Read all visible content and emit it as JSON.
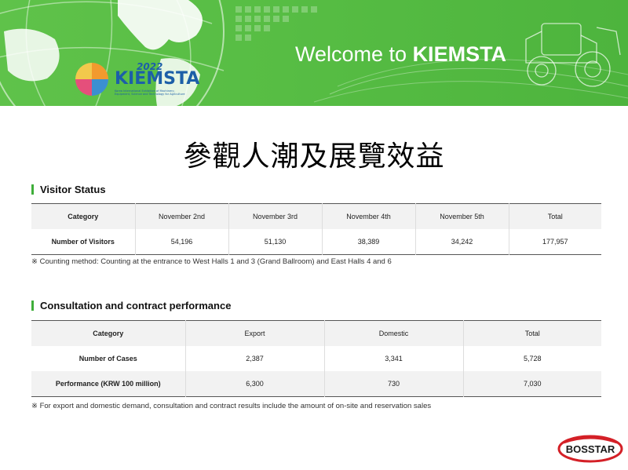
{
  "banner": {
    "logo_year": "2022",
    "logo_name": "KIEMSTA",
    "logo_subtitle": "Korea International Exhibition of Machinery, Equipment, Science and Technology for Agriculture",
    "welcome_prefix": "Welcome to ",
    "welcome_brand": "KIEMSTA",
    "bg_color": "#57bd44"
  },
  "page_title": "參觀人潮及展覽效益",
  "visitor_status": {
    "title": "Visitor Status",
    "headers": [
      "Category",
      "November 2nd",
      "November 3rd",
      "November 4th",
      "November 5th",
      "Total"
    ],
    "rows": [
      [
        "Number of Visitors",
        "54,196",
        "51,130",
        "38,389",
        "34,242",
        "177,957"
      ]
    ],
    "note": "※ Counting method: Counting at the entrance to West Halls 1 and 3 (Grand Ballroom) and East Halls 4 and 6"
  },
  "consultation": {
    "title": "Consultation and contract performance",
    "headers": [
      "Category",
      "Export",
      "Domestic",
      "Total"
    ],
    "rows": [
      [
        "Number of Cases",
        "2,387",
        "3,341",
        "5,728"
      ],
      [
        "Performance (KRW 100 million)",
        "6,300",
        "730",
        "7,030"
      ]
    ],
    "note": "※ For export and domestic demand, consultation and contract results include the amount of on-site and reservation sales"
  },
  "footer_logo": {
    "text": "BOSSTAR",
    "color": "#d42027"
  }
}
